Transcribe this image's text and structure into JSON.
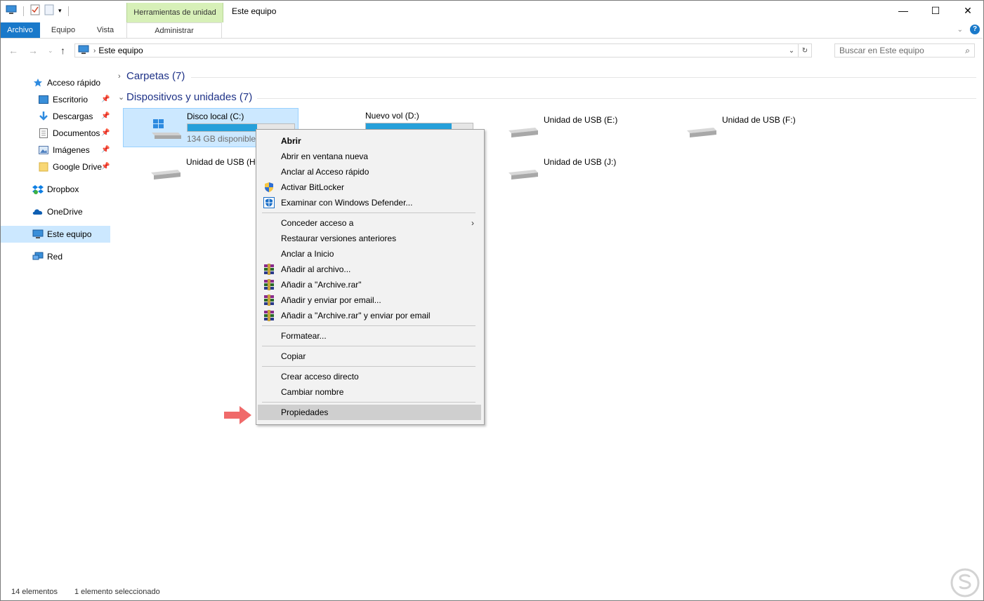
{
  "titlebar": {
    "contextual_tab_group": "Herramientas de unidad",
    "window_title": "Este equipo",
    "minimize": "—",
    "maximize": "☐",
    "close": "✕"
  },
  "ribbon_tabs": [
    "Archivo",
    "Equipo",
    "Vista",
    "Administrar"
  ],
  "address": {
    "path": "Este equipo",
    "search_placeholder": "Buscar en Este equipo"
  },
  "sidebar": {
    "items": [
      {
        "label": "Acceso rápido",
        "icon": "star-icon"
      },
      {
        "label": "Escritorio",
        "icon": "desktop-icon",
        "pinned": true
      },
      {
        "label": "Descargas",
        "icon": "download-icon",
        "pinned": true
      },
      {
        "label": "Documentos",
        "icon": "document-icon",
        "pinned": true
      },
      {
        "label": "Imágenes",
        "icon": "pictures-icon",
        "pinned": true
      },
      {
        "label": "Google Drive",
        "icon": "folder-icon",
        "pinned": true
      },
      {
        "label": "Dropbox",
        "icon": "dropbox-icon"
      },
      {
        "label": "OneDrive",
        "icon": "cloud-icon"
      },
      {
        "label": "Este equipo",
        "icon": "computer-icon",
        "selected": true
      },
      {
        "label": "Red",
        "icon": "network-icon"
      }
    ]
  },
  "groups": {
    "folders": "Carpetas (7)",
    "devices": "Dispositivos y unidades (7)"
  },
  "drives": [
    {
      "name": "Disco local (C:)",
      "free": "134 GB disponibles",
      "used_fraction": 0.65,
      "selected": true
    },
    {
      "name": "Nuevo vol (D:)",
      "used_fraction": 0.8
    },
    {
      "name": "Unidad de USB (E:)"
    },
    {
      "name": "Unidad de USB (F:)"
    },
    {
      "name": "Unidad de USB (H:)"
    },
    {
      "name": "Unidad de USB (J:)"
    }
  ],
  "context_menu": {
    "items": [
      {
        "label": "Abrir",
        "bold": true
      },
      {
        "label": "Abrir en ventana nueva"
      },
      {
        "label": "Anclar al Acceso rápido"
      },
      {
        "label": "Activar BitLocker",
        "icon": "shield-icon"
      },
      {
        "label": "Examinar con Windows Defender...",
        "icon": "defender-icon"
      },
      {
        "label": "Conceder acceso a",
        "submenu": true
      },
      {
        "label": "Restaurar versiones anteriores"
      },
      {
        "label": "Anclar a Inicio"
      },
      {
        "label": "Añadir al archivo...",
        "icon": "winrar-icon"
      },
      {
        "label": "Añadir a \"Archive.rar\"",
        "icon": "winrar-icon"
      },
      {
        "label": "Añadir y enviar por email...",
        "icon": "winrar-icon"
      },
      {
        "label": "Añadir a \"Archive.rar\" y enviar por email",
        "icon": "winrar-icon"
      },
      {
        "label": "Formatear..."
      },
      {
        "label": "Copiar"
      },
      {
        "label": "Crear acceso directo"
      },
      {
        "label": "Cambiar nombre"
      },
      {
        "label": "Propiedades",
        "highlighted": true
      }
    ]
  },
  "status": {
    "count": "14 elementos",
    "selection": "1 elemento seleccionado"
  },
  "colors": {
    "accent": "#1979ca",
    "selection": "#cce8ff",
    "context_tab": "#d7f0b8",
    "arrow": "#f06a6a",
    "drive_fill": "#26a0da"
  }
}
